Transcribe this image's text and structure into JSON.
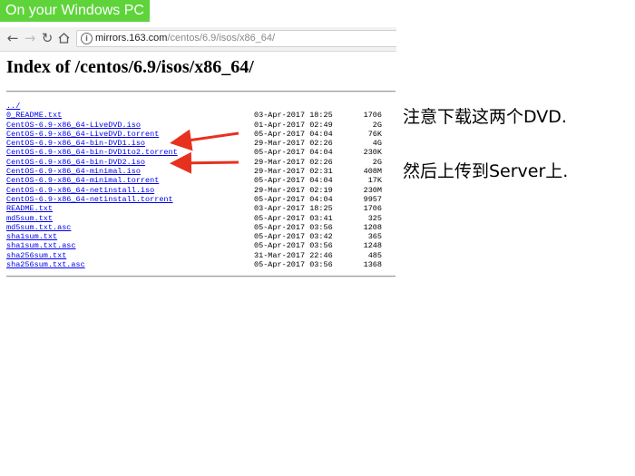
{
  "tag": "On your Windows PC",
  "browser": {
    "url_host": "mirrors.163.com",
    "url_path": "/centos/6.9/isos/x86_64/"
  },
  "page": {
    "title": "Index of /centos/6.9/isos/x86_64/",
    "parent_link": "../",
    "files": [
      {
        "name": "0_README.txt",
        "date": "03-Apr-2017 18:25",
        "size": "1706"
      },
      {
        "name": "CentOS-6.9-x86_64-LiveDVD.iso",
        "date": "01-Apr-2017 02:49",
        "size": "2G"
      },
      {
        "name": "CentOS-6.9-x86_64-LiveDVD.torrent",
        "date": "05-Apr-2017 04:04",
        "size": "76K"
      },
      {
        "name": "CentOS-6.9-x86_64-bin-DVD1.iso",
        "date": "29-Mar-2017 02:26",
        "size": "4G"
      },
      {
        "name": "CentOS-6.9-x86_64-bin-DVD1to2.torrent",
        "date": "05-Apr-2017 04:04",
        "size": "230K"
      },
      {
        "name": "CentOS-6.9-x86_64-bin-DVD2.iso",
        "date": "29-Mar-2017 02:26",
        "size": "2G"
      },
      {
        "name": "CentOS-6.9-x86_64-minimal.iso",
        "date": "29-Mar-2017 02:31",
        "size": "408M"
      },
      {
        "name": "CentOS-6.9-x86_64-minimal.torrent",
        "date": "05-Apr-2017 04:04",
        "size": "17K"
      },
      {
        "name": "CentOS-6.9-x86_64-netinstall.iso",
        "date": "29-Mar-2017 02:19",
        "size": "230M"
      },
      {
        "name": "CentOS-6.9-x86_64-netinstall.torrent",
        "date": "05-Apr-2017 04:04",
        "size": "9957"
      },
      {
        "name": "README.txt",
        "date": "03-Apr-2017 18:25",
        "size": "1706"
      },
      {
        "name": "md5sum.txt",
        "date": "05-Apr-2017 03:41",
        "size": "325"
      },
      {
        "name": "md5sum.txt.asc",
        "date": "05-Apr-2017 03:56",
        "size": "1208"
      },
      {
        "name": "sha1sum.txt",
        "date": "05-Apr-2017 03:42",
        "size": "365"
      },
      {
        "name": "sha1sum.txt.asc",
        "date": "05-Apr-2017 03:56",
        "size": "1248"
      },
      {
        "name": "sha256sum.txt",
        "date": "31-Mar-2017 22:46",
        "size": "485"
      },
      {
        "name": "sha256sum.txt.asc",
        "date": "05-Apr-2017 03:56",
        "size": "1368"
      }
    ]
  },
  "notes": {
    "line1": "注意下载这两个DVD.",
    "line2": "然后上传到Server上."
  },
  "colors": {
    "tag_bg": "#5ed43a",
    "link": "#0000ee",
    "arrow": "#e8301f"
  },
  "icons": [
    "back-arrow-icon",
    "forward-arrow-icon",
    "reload-icon",
    "home-icon",
    "info-icon"
  ]
}
